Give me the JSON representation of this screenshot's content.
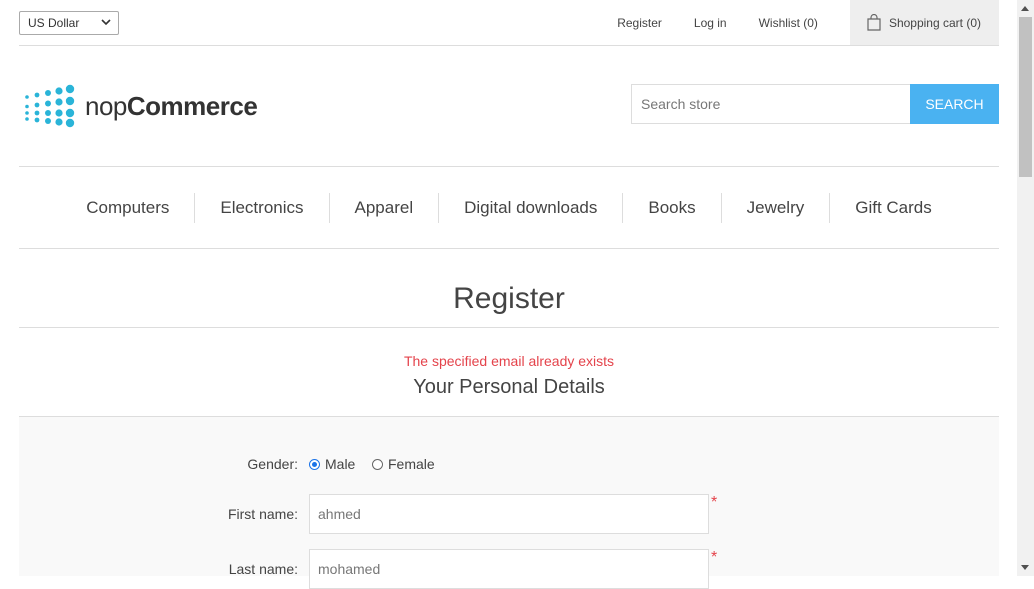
{
  "header": {
    "currency": "US Dollar",
    "links": {
      "register": "Register",
      "login": "Log in",
      "wishlist": "Wishlist (0)",
      "cart": "Shopping cart (0)"
    }
  },
  "logo": {
    "prefix": "nop",
    "brand": "Commerce"
  },
  "search": {
    "placeholder": "Search store",
    "button": "SEARCH"
  },
  "menu": [
    "Computers",
    "Electronics",
    "Apparel",
    "Digital downloads",
    "Books",
    "Jewelry",
    "Gift Cards"
  ],
  "page": {
    "title": "Register",
    "error": "The specified email already exists",
    "section": "Your Personal Details"
  },
  "form": {
    "gender_label": "Gender:",
    "male": "Male",
    "female": "Female",
    "gender_selected": "Male",
    "first_name_label": "First name:",
    "first_name_value": "ahmed",
    "last_name_label": "Last name:",
    "last_name_value": "mohamed",
    "required_mark": "*"
  },
  "colors": {
    "accent": "#4ab2f1",
    "error": "#e4434b",
    "logo_dots": "#2ab4d8"
  }
}
